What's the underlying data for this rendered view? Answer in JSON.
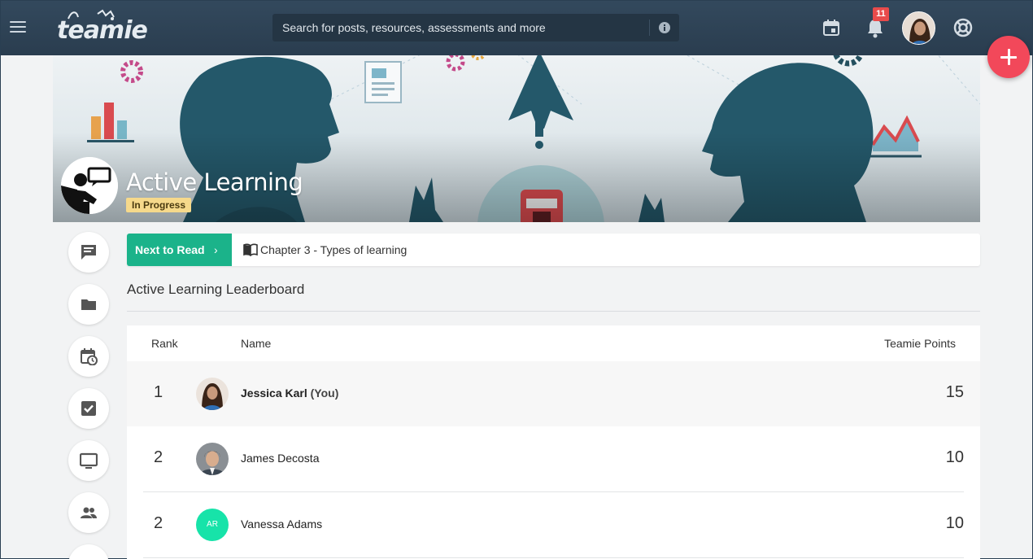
{
  "app": {
    "logo_text": "teamie"
  },
  "search": {
    "placeholder": "Search for posts, resources, assessments and more"
  },
  "notifications": {
    "count": "11"
  },
  "course": {
    "title": "Active Learning",
    "status": "In Progress"
  },
  "next_to_read": {
    "label": "Next to Read",
    "chevron": "›",
    "chapter": "Chapter 3 - Types of learning"
  },
  "leaderboard": {
    "title": "Active Learning Leaderboard",
    "columns": {
      "rank": "Rank",
      "name": "Name",
      "points": "Teamie Points"
    },
    "rows": [
      {
        "rank": "1",
        "name": "Jessica Karl",
        "you_tag": "(You)",
        "points": "15"
      },
      {
        "rank": "2",
        "name": "James Decosta",
        "points": "10"
      },
      {
        "rank": "2",
        "name": "Vanessa Adams",
        "initials": "AR",
        "points": "10"
      }
    ]
  },
  "colors": {
    "topbar": "#2c3e50",
    "accent_green": "#1bb38a",
    "fab_red": "#f2485a",
    "badge_red": "#e84b4b",
    "status_yellow": "#f6d98b",
    "initials_teal": "#17e3a9"
  },
  "icons": {
    "menu": "hamburger-icon",
    "info": "info-icon",
    "calendar": "calendar-icon",
    "bell": "bell-icon",
    "help": "lifebuoy-icon",
    "add": "plus-icon",
    "rail": [
      "chat-icon",
      "folder-icon",
      "calendar-clock-icon",
      "checkbox-icon",
      "monitor-icon",
      "people-icon"
    ],
    "book": "book-icon"
  }
}
